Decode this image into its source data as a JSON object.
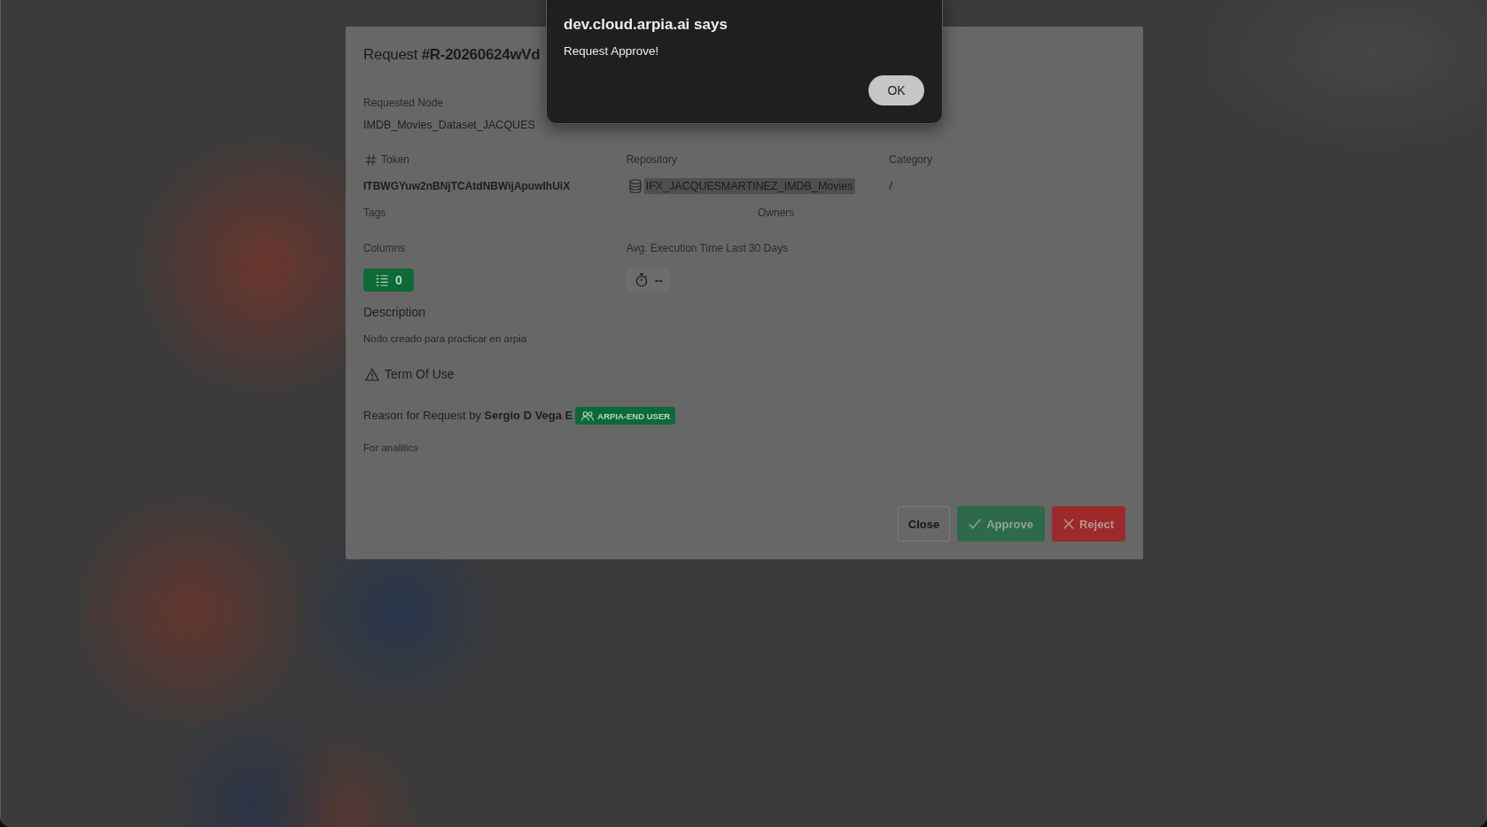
{
  "alert": {
    "title": "dev.cloud.arpia.ai says",
    "message": "Request Approve!",
    "button": "OK"
  },
  "request_dialog": {
    "title": "Request **#R-20260624wVd**",
    "requested_node": {
      "label": "Requested Node",
      "value": "IMDB_Movies_Dataset_JACQUES"
    },
    "details": [
      {
        "kind": "token",
        "label": "Token",
        "value": "ITBWGYuw2nBNjTCAtdNBWijApuwlhUiX",
        "highlighted": false
      },
      {
        "kind": "repository",
        "label": "Repository",
        "value": "IFX_JACQUESMARTINEZ_IMDB_Movies",
        "highlighted": true
      },
      {
        "kind": "plain",
        "label": "Category",
        "value": "/",
        "highlighted": false
      }
    ],
    "meta": [
      {
        "label": "Tags"
      },
      {
        "label": "Owners"
      }
    ],
    "metrics": [
      {
        "kind": "columns",
        "label": "Columns",
        "value": "0"
      },
      {
        "kind": "duration",
        "label": "Avg. Execution Time Last 30 Days",
        "value": "--"
      }
    ],
    "description": {
      "heading": "Description",
      "text": "Nodo creado para practicar en arpia"
    },
    "terms": {
      "label": "Term Of Use"
    },
    "reason": {
      "heading": "Reason for Request by **Sergio D Vega E**",
      "role": "ARPIA-END USER",
      "text": "For analitics"
    },
    "buttons": [
      {
        "kind": "secondary",
        "label": "Close",
        "disabled": false
      },
      {
        "kind": "success",
        "label": "Approve",
        "disabled": true
      },
      {
        "kind": "danger",
        "label": "Reject",
        "disabled": true
      }
    ]
  }
}
